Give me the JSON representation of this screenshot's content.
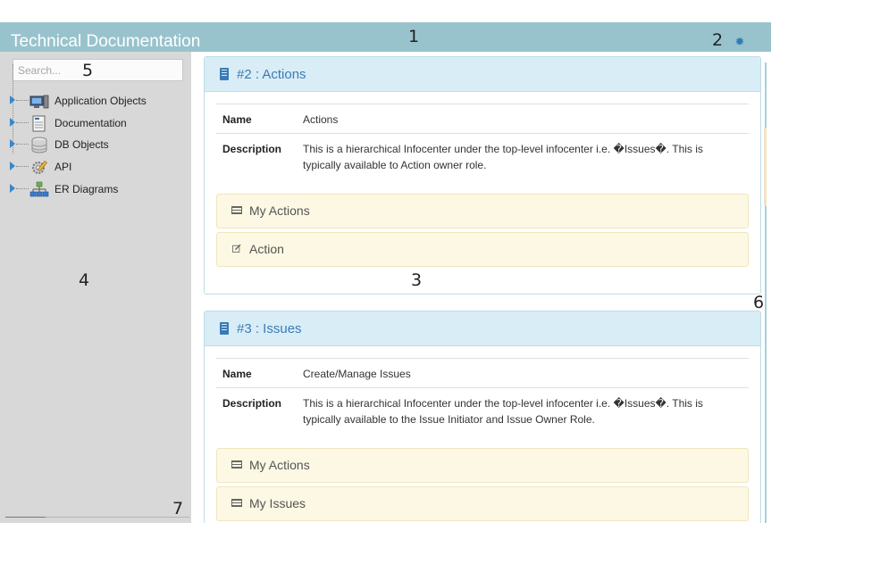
{
  "app": {
    "title": "Technical Documentation",
    "settings_icon": "gear-icon",
    "accent_color": "#98c3cc"
  },
  "sidebar": {
    "search_placeholder": "Search...",
    "tree": [
      {
        "label": "Application Objects",
        "icon": "computer-icon"
      },
      {
        "label": "Documentation",
        "icon": "document-icon"
      },
      {
        "label": "DB Objects",
        "icon": "database-icon"
      },
      {
        "label": "API",
        "icon": "gear-pencil-icon"
      },
      {
        "label": "ER Diagrams",
        "icon": "sitemap-icon"
      }
    ]
  },
  "panels": [
    {
      "title": "#2 : Actions",
      "name_label": "Name",
      "name_value": "Actions",
      "description_label": "Description",
      "description_value": "This is a hierarchical Infocenter under the top-level infocenter i.e. �Issues�. This is typically available to Action owner role.",
      "actions": [
        {
          "label": "My Actions",
          "icon": "list-icon"
        },
        {
          "label": "Action",
          "icon": "edit-icon"
        }
      ]
    },
    {
      "title": "#3 : Issues",
      "name_label": "Name",
      "name_value": "Create/Manage Issues",
      "description_label": "Description",
      "description_value": "This is a hierarchical Infocenter under the top-level infocenter i.e. �Issues�. This is typically available to the Issue Initiator and Issue Owner Role.",
      "actions": [
        {
          "label": "My Actions",
          "icon": "list-icon"
        },
        {
          "label": "My Issues",
          "icon": "list-icon"
        }
      ]
    }
  ],
  "annotations": [
    "1",
    "2",
    "3",
    "4",
    "5",
    "6",
    "7"
  ]
}
